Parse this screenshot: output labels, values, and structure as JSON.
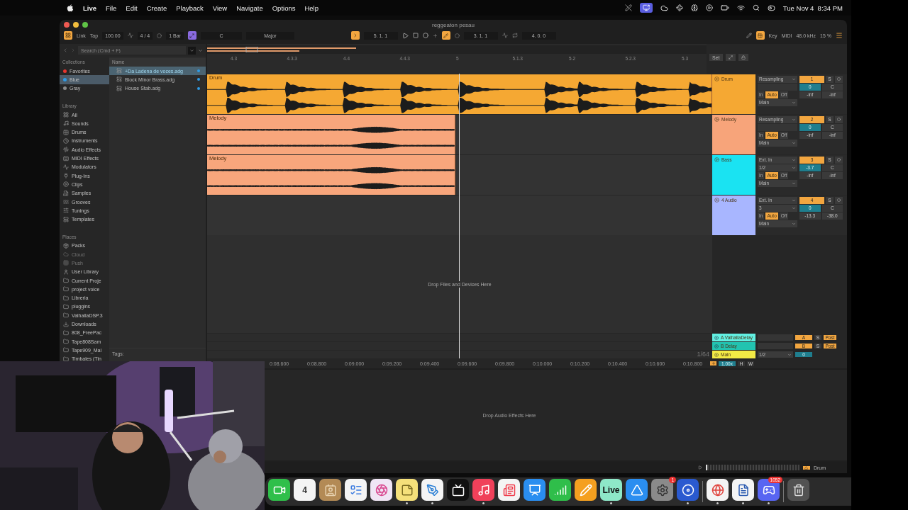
{
  "menu_bar": {
    "app": "Live",
    "menus": [
      "File",
      "Edit",
      "Create",
      "Playback",
      "View",
      "Navigate",
      "Options",
      "Help"
    ],
    "clock": "Tue Nov 4  8:34 PM"
  },
  "window": {
    "title": "reggeaton pesau"
  },
  "control_bar": {
    "link": "Link",
    "tap": "Tap",
    "tempo": "100.00",
    "signature": "4 / 4",
    "quantization": "1 Bar",
    "key": "C",
    "scale": "Major",
    "position": "5. 1. 1",
    "loop_start": "3. 1. 1",
    "loop_length": "4. 0. 0",
    "key_button": "Key",
    "midi_button": "MIDI",
    "sample_rate": "48.0 kHz",
    "cpu": "15 %"
  },
  "browser": {
    "search": {
      "placeholder": "Search (Cmd + F)"
    },
    "collections_heading": "Collections",
    "collections": [
      {
        "label": "Favorites",
        "color": "#e5352f",
        "selected": false
      },
      {
        "label": "Blue",
        "color": "#2f9be5",
        "selected": true
      },
      {
        "label": "Gray",
        "color": "#8a8a8a",
        "selected": false
      }
    ],
    "library_heading": "Library",
    "library": [
      {
        "label": "All",
        "kind": "all"
      },
      {
        "label": "Sounds",
        "kind": "sounds"
      },
      {
        "label": "Drums",
        "kind": "drums"
      },
      {
        "label": "Instruments",
        "kind": "instruments"
      },
      {
        "label": "Audio Effects",
        "kind": "audio_effects"
      },
      {
        "label": "MIDI Effects",
        "kind": "midi_effects"
      },
      {
        "label": "Modulators",
        "kind": "modulators"
      },
      {
        "label": "Plug-Ins",
        "kind": "plugins"
      },
      {
        "label": "Clips",
        "kind": "clips"
      },
      {
        "label": "Samples",
        "kind": "samples"
      },
      {
        "label": "Grooves",
        "kind": "grooves"
      },
      {
        "label": "Tunings",
        "kind": "tunings"
      },
      {
        "label": "Templates",
        "kind": "templates"
      }
    ],
    "places_heading": "Places",
    "places": [
      {
        "label": "Packs",
        "kind": "packs",
        "disabled": false
      },
      {
        "label": "Cloud",
        "kind": "cloud",
        "disabled": true
      },
      {
        "label": "Push",
        "kind": "device",
        "disabled": true
      },
      {
        "label": "User Library",
        "kind": "user",
        "disabled": false
      },
      {
        "label": "Current Proje",
        "kind": "folder",
        "disabled": false
      },
      {
        "label": "project voice",
        "kind": "folder",
        "disabled": false
      },
      {
        "label": "Libreria",
        "kind": "folder",
        "disabled": false
      },
      {
        "label": "pluggins",
        "kind": "folder",
        "disabled": false
      },
      {
        "label": "ValhallaDSP.3",
        "kind": "folder",
        "disabled": false
      },
      {
        "label": "Downloads",
        "kind": "downloads",
        "disabled": false
      },
      {
        "label": "808_FreePac",
        "kind": "folder",
        "disabled": false
      },
      {
        "label": "Tape808Sam",
        "kind": "folder",
        "disabled": false
      },
      {
        "label": "Tape909_Mai",
        "kind": "folder",
        "disabled": false
      },
      {
        "label": "Timbales (Tin",
        "kind": "folder",
        "disabled": false
      }
    ],
    "name_column": "Name",
    "files": [
      {
        "name": "+Da Ladena de voces.adg",
        "color": "#2f9be5",
        "selected": true
      },
      {
        "name": "Block Minor Brass.adg",
        "color": "#2f9be5",
        "selected": false
      },
      {
        "name": "House Stab.adg",
        "color": "#2f9be5",
        "selected": false
      }
    ],
    "tags_label": "Tags:"
  },
  "arrangement": {
    "ruler": [
      "4.3",
      "4.3.3",
      "4.4",
      "4.4.3",
      "5",
      "5.1.3",
      "5.2",
      "5.2.3",
      "5.3"
    ],
    "set_button": "Set",
    "tracks": [
      {
        "name": "Drum",
        "color": "#f5a833",
        "clip": {
          "name": "Drum",
          "kind": "drums",
          "color": "#f5a833"
        },
        "input": "Resampling",
        "monitor": [
          {
            "label": "In",
            "selected": false
          },
          {
            "label": "Auto",
            "selected": true
          },
          {
            "label": "Off",
            "selected": false
          }
        ],
        "output": "Main",
        "number": "1",
        "solo": "S",
        "volume": "0",
        "pan": "C",
        "meters": [
          "-inf",
          "-inf"
        ]
      },
      {
        "name": "Melody",
        "color": "#f7a47a",
        "clip": {
          "name": "Melody",
          "kind": "melody",
          "color": "#f8a67c"
        },
        "input": "Resampling",
        "monitor": [
          {
            "label": "In",
            "selected": false
          },
          {
            "label": "Auto",
            "selected": true
          },
          {
            "label": "Off",
            "selected": false
          }
        ],
        "output": "Main",
        "number": "2",
        "solo": "S",
        "volume": "0",
        "pan": "C",
        "meters": [
          "-inf",
          "-inf"
        ]
      },
      {
        "name": "Bass",
        "color": "#1ae3f2",
        "clip": {
          "name": "Melody",
          "kind": "melody",
          "color": "#f8a67c"
        },
        "input": "Ext. In",
        "channel": "1/2",
        "monitor": [
          {
            "label": "In",
            "selected": false
          },
          {
            "label": "Auto",
            "selected": true
          },
          {
            "label": "Off",
            "selected": false
          }
        ],
        "output": "Main",
        "number": "3",
        "solo": "S",
        "volume": "-3.7",
        "pan": "C",
        "meters": [
          "-inf",
          "-inf"
        ]
      },
      {
        "name": "4 Audio",
        "color": "#a8b6ff",
        "input": "Ext. In",
        "channel": "3",
        "monitor": [
          {
            "label": "In",
            "selected": false
          },
          {
            "label": "Auto",
            "selected": true
          },
          {
            "label": "Off",
            "selected": false
          }
        ],
        "output": "Main",
        "number": "4",
        "solo": "S",
        "volume": "0",
        "pan": "C",
        "meters": [
          "-13.3",
          "-38.0"
        ]
      }
    ],
    "drop_hint": "Drop Files and Devices Here",
    "returns": [
      {
        "name": "A ValhallaDelay",
        "color": "#62f0e2",
        "send": "A",
        "solo": "S",
        "mode": "Post"
      },
      {
        "name": "B Delay",
        "color": "#22c3b0",
        "send": "B",
        "solo": "S",
        "mode": "Post"
      }
    ],
    "main": {
      "name": "Main",
      "color": "#f2ea45",
      "channel": "1/2",
      "volume": "0"
    },
    "grid": "1/64",
    "time_ruler": [
      "0:08.600",
      "0:08.800",
      "0:09.000",
      "0:09.200",
      "0:09.400",
      "0:09.600",
      "0:09.800",
      "0:10.000",
      "0:10.200",
      "0:10.400",
      "0:10.600",
      "0:10.800"
    ],
    "zoom": "1.00x",
    "h_button": "H",
    "w_button": "W"
  },
  "detail_view": {
    "drop_hint": "Drop Audio Effects Here"
  },
  "status_bar": {
    "selected_track": "Drum"
  },
  "dock": {
    "apps": [
      {
        "kind": "facetime",
        "running": false
      },
      {
        "kind": "calendar",
        "label": "4",
        "running": false
      },
      {
        "kind": "contacts",
        "running": false
      },
      {
        "kind": "reminders",
        "running": false
      },
      {
        "kind": "photos",
        "running": false
      },
      {
        "kind": "notes",
        "running": true
      },
      {
        "kind": "freeform",
        "running": true
      },
      {
        "kind": "tv",
        "running": false
      },
      {
        "kind": "music",
        "running": true
      },
      {
        "kind": "news",
        "running": false
      },
      {
        "kind": "keynote",
        "running": false
      },
      {
        "kind": "numbers",
        "running": false
      },
      {
        "kind": "pages",
        "running": false
      },
      {
        "kind": "live",
        "label": "Live",
        "running": true
      },
      {
        "kind": "appstore",
        "running": false
      },
      {
        "kind": "settings",
        "badge": "1",
        "running": false
      },
      {
        "kind": "drv",
        "running": true
      },
      {
        "kind": "chrome",
        "running": true
      },
      {
        "kind": "word",
        "running": true
      },
      {
        "kind": "discord",
        "badge": "1052",
        "running": true
      },
      {
        "kind": "trash",
        "running": false
      }
    ]
  }
}
